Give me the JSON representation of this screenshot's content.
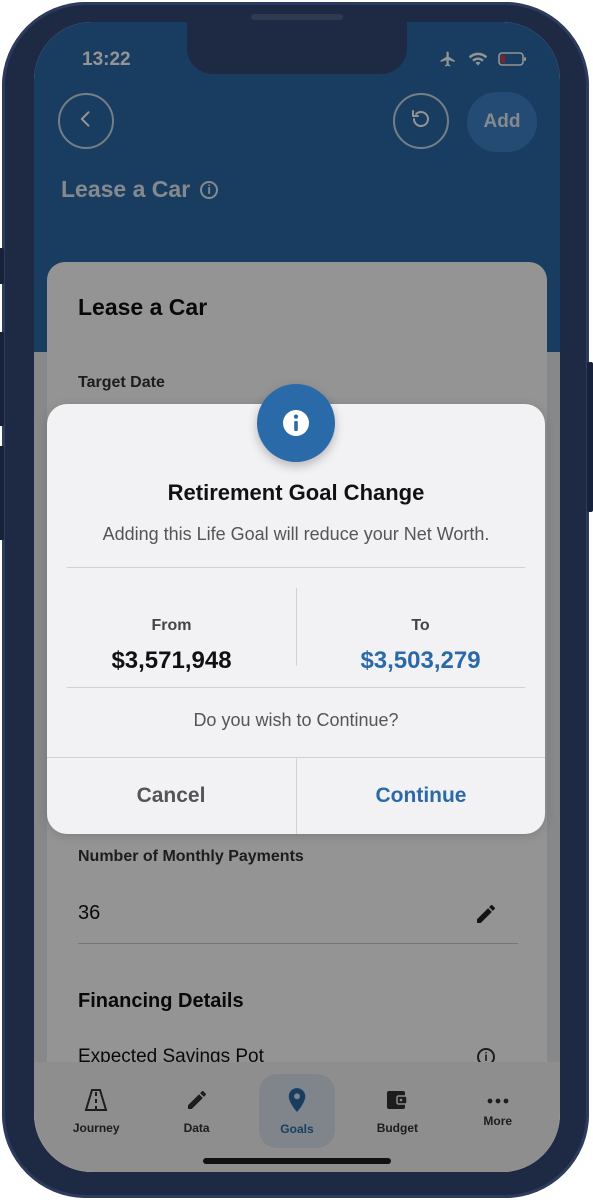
{
  "status_bar": {
    "time": "13:22",
    "icons": [
      "airplane-icon",
      "wifi-icon",
      "battery-low-icon"
    ],
    "battery_color": "#e53935"
  },
  "header": {
    "back_icon": "chevron-left-icon",
    "refresh_icon": "refresh-icon",
    "add_label": "Add",
    "title": "Lease a Car",
    "title_icon": "info-icon"
  },
  "card": {
    "title": "Lease a Car",
    "target_date_label": "Target Date",
    "monthly_payments_label": "Number of Monthly Payments",
    "monthly_payments_value": "36",
    "financing_title": "Financing Details",
    "savings_pot_label": "Expected Savings Pot"
  },
  "dialog": {
    "icon": "info-icon",
    "title": "Retirement Goal Change",
    "message": "Adding this Life Goal will reduce your Net Worth.",
    "from_label": "From",
    "from_value": "$3,571,948",
    "to_label": "To",
    "to_value": "$3,503,279",
    "question": "Do you wish to Continue?",
    "cancel_label": "Cancel",
    "continue_label": "Continue"
  },
  "nav": {
    "items": [
      {
        "label": "Journey",
        "icon": "road-icon",
        "active": false
      },
      {
        "label": "Data",
        "icon": "pencil-icon",
        "active": false
      },
      {
        "label": "Goals",
        "icon": "location-pin-icon",
        "active": true
      },
      {
        "label": "Budget",
        "icon": "wallet-icon",
        "active": false
      },
      {
        "label": "More",
        "icon": "more-dots-icon",
        "active": false
      }
    ]
  },
  "colors": {
    "brand_blue": "#2b6aa8",
    "accent_blue": "#2b6aa8",
    "phone_frame": "#1e2a44"
  }
}
